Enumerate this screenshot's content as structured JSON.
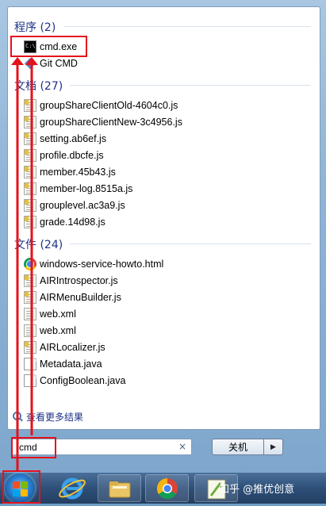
{
  "sections": [
    {
      "header": "程序 (2)",
      "items": [
        {
          "label": "cmd.exe",
          "icon": "cmd-icon"
        },
        {
          "label": "Git CMD",
          "icon": "git-icon"
        }
      ]
    },
    {
      "header": "文档 (27)",
      "items": [
        {
          "label": "groupShareClientOld-4604c0.js",
          "icon": "js-file-icon"
        },
        {
          "label": "groupShareClientNew-3c4956.js",
          "icon": "js-file-icon"
        },
        {
          "label": "setting.ab6ef.js",
          "icon": "js-file-icon"
        },
        {
          "label": "profile.dbcfe.js",
          "icon": "js-file-icon"
        },
        {
          "label": "member.45b43.js",
          "icon": "js-file-icon"
        },
        {
          "label": "member-log.8515a.js",
          "icon": "js-file-icon"
        },
        {
          "label": "grouplevel.ac3a9.js",
          "icon": "js-file-icon"
        },
        {
          "label": "grade.14d98.js",
          "icon": "js-file-icon"
        }
      ]
    },
    {
      "header": "文件 (24)",
      "items": [
        {
          "label": "windows-service-howto.html",
          "icon": "chrome-html-icon"
        },
        {
          "label": "AIRIntrospector.js",
          "icon": "js-file-icon"
        },
        {
          "label": "AIRMenuBuilder.js",
          "icon": "js-file-icon"
        },
        {
          "label": "web.xml",
          "icon": "xml-file-icon"
        },
        {
          "label": "web.xml",
          "icon": "xml-file-icon"
        },
        {
          "label": "AIRLocalizer.js",
          "icon": "js-file-icon"
        },
        {
          "label": "Metadata.java",
          "icon": "java-file-icon"
        },
        {
          "label": "ConfigBoolean.java",
          "icon": "java-file-icon"
        }
      ]
    }
  ],
  "see_more": "查看更多结果",
  "search": {
    "value": "cmd",
    "clear": "×"
  },
  "shutdown": {
    "label": "关机",
    "arrow": "▶"
  },
  "taskbar": {
    "apps": [
      "internet-explorer-icon",
      "file-explorer-icon",
      "chrome-icon",
      "notepad-plus-plus-icon"
    ],
    "watermark": "知乎 @推优创意"
  },
  "accent": {
    "annotation": "#e4121b",
    "header_text": "#1e3287"
  }
}
